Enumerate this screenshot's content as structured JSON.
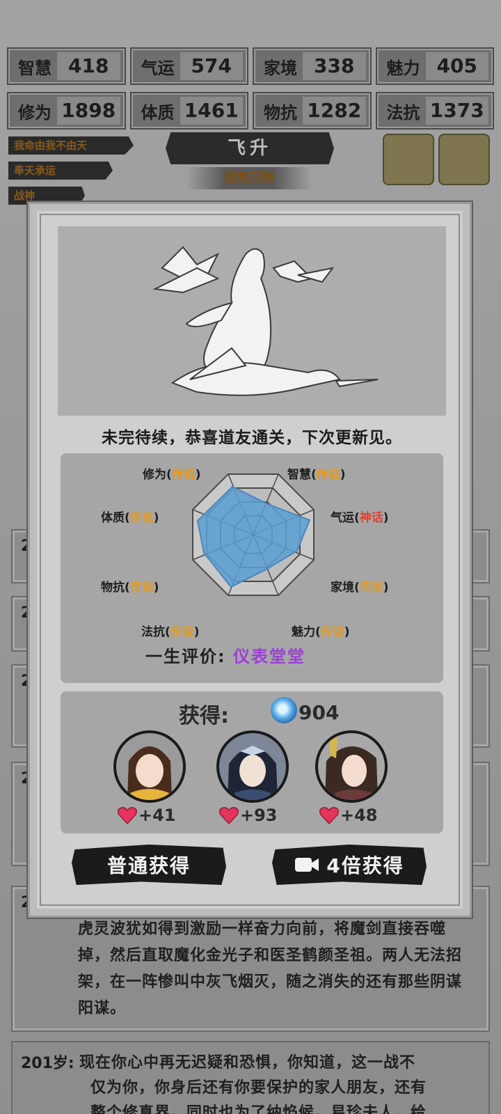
{
  "stats": [
    {
      "label": "智慧",
      "value": "418"
    },
    {
      "label": "气运",
      "value": "574"
    },
    {
      "label": "家境",
      "value": "338"
    },
    {
      "label": "魅力",
      "value": "405"
    },
    {
      "label": "修为",
      "value": "1898"
    },
    {
      "label": "体质",
      "value": "1461"
    },
    {
      "label": "物抗",
      "value": "1282"
    },
    {
      "label": "法抗",
      "value": "1373"
    }
  ],
  "traits": [
    "我命由我不由天",
    "奉天承运",
    "战神"
  ],
  "realm": {
    "title": "飞升",
    "subtitle": "超脱万物"
  },
  "modal": {
    "caption": "未完待续，恭喜道友通关，下次更新见。",
    "radar": {
      "labels": [
        {
          "name": "修为",
          "grade": "传说"
        },
        {
          "name": "智慧",
          "grade": "传说"
        },
        {
          "name": "体质",
          "grade": "传说"
        },
        {
          "name": "气运",
          "grade": "神话"
        },
        {
          "name": "物抗",
          "grade": "传说"
        },
        {
          "name": "家境",
          "grade": "传说"
        },
        {
          "name": "法抗",
          "grade": "传说"
        },
        {
          "name": "魅力",
          "grade": "传说"
        }
      ],
      "colors": {
        "legend": "#e39a22",
        "myth": "#e04033",
        "fill": "#5a9fd4"
      }
    },
    "evaluation": {
      "label": "一生评价:",
      "value": "仪表堂堂"
    },
    "reward": {
      "label": "获得:",
      "amount": "904",
      "companions": [
        {
          "avatar": "companion-1",
          "affinity": "+41"
        },
        {
          "avatar": "companion-2",
          "affinity": "+93"
        },
        {
          "avatar": "companion-3",
          "affinity": "+48"
        }
      ]
    },
    "buttons": {
      "normal": "普通获得",
      "video": "4倍获得"
    }
  },
  "log": {
    "story": "虎灵波犹如得到激励一样奋力向前，将魔剑直接吞噬掉，然后直取魔化金光子和医圣鹤颜圣祖。两人无法招架，在一阵惨叫中灰飞烟灭，随之消失的还有那些阴谋阳谋。",
    "last_age": "201岁:",
    "last_text_1": "现在你心中再无迟疑和恐惧，你知道，这一战不",
    "last_text_2": "仅为你，你身后还有你要保护的家人朋友，还有",
    "last_text_3": "整个修真界，同时也为了纳焰候，易珍夫人，给"
  },
  "partial_ages": [
    "20",
    "20",
    "20",
    "20",
    "20"
  ]
}
